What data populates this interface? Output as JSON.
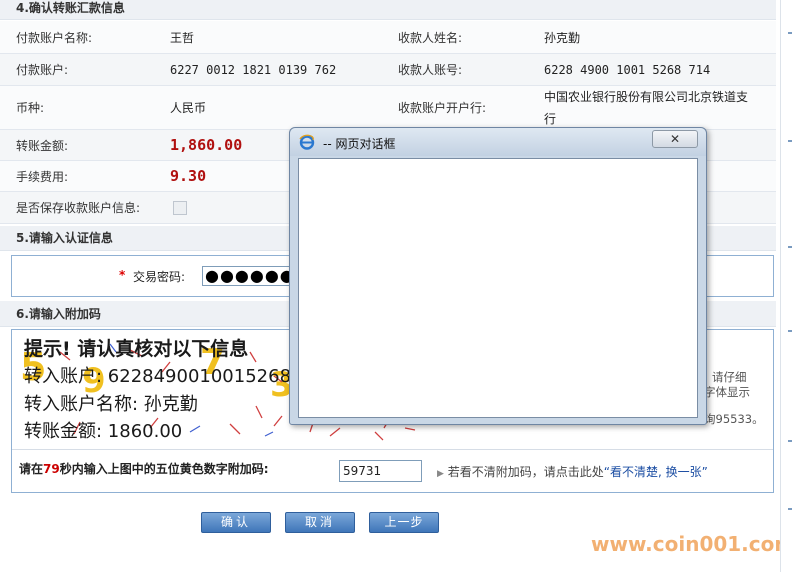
{
  "sections": {
    "confirm": "4.确认转账汇款信息",
    "auth": "5.请输入认证信息",
    "extra": "6.请输入附加码"
  },
  "info": {
    "payer_name_label": "付款账户名称:",
    "payer_name": "王哲",
    "payee_name_label": "收款人姓名:",
    "payee_name": "孙克勤",
    "payer_account_label": "付款账户:",
    "payer_account": "6227 0012 1821 0139 762",
    "payee_account_label": "收款人账号:",
    "payee_account": "6228 4900 1001 5268 714",
    "currency_label": "币种:",
    "currency": "人民币",
    "bank_label": "收款账户开户行:",
    "bank_line1": "中国农业银行股份有限公司北京铁道支",
    "bank_line2": "行",
    "amount_label": "转账金额:",
    "amount": "1,860.00",
    "fee_label": "手续费用:",
    "fee": "9.30",
    "save_label": "是否保存收款账户信息:"
  },
  "auth": {
    "password_label": "交易密码:",
    "password_mask": "●●●●●●●●"
  },
  "captcha": {
    "title": "提示! 请认真核对以下信息",
    "line1": "转入账户: 6228490010015268714",
    "line2": "转入账户名称: 孙克勤",
    "line3": "转账金额: 1860.00",
    "side_text1": "请仔细",
    "side_text2": "字体显示",
    "side_text3": "询95533。",
    "prompt_pre": "请在",
    "countdown": "79",
    "prompt_post": "秒内输入上图中的五位黄色数字附加码:",
    "input_value": "59731",
    "hint_pre": "若看不清附加码，请点击此处",
    "hint_link": "“看不清楚, 换一张”"
  },
  "buttons": {
    "confirm": "确认",
    "cancel": "取消",
    "prev": "上一步"
  },
  "dialog": {
    "title": "-- 网页对话框",
    "close_glyph": "✕"
  },
  "watermark": "www.coin001.com"
}
